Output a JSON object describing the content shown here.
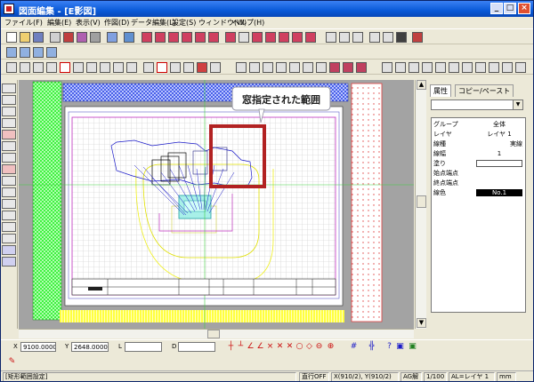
{
  "window": {
    "title": "図面編集 - [E影図]"
  },
  "menu": [
    {
      "label": "ファイル(F)"
    },
    {
      "label": "編集(E)"
    },
    {
      "label": "表示(V)"
    },
    {
      "label": "作図(D)"
    },
    {
      "label": "データ編集(L)"
    },
    {
      "label": "設定(S)"
    },
    {
      "label": "ウィンドウ(W)"
    },
    {
      "label": "ヘルプ(H)"
    }
  ],
  "panel": {
    "tabs": [
      {
        "label": "属性"
      },
      {
        "label": "コピー/ペースト"
      }
    ],
    "properties": [
      {
        "key": "グループ",
        "value": "全体"
      },
      {
        "key": "レイヤ",
        "value": "レイヤ 1"
      },
      {
        "key": "線種",
        "value": "実線"
      },
      {
        "key": "線幅",
        "value": "1"
      },
      {
        "key": "塗り",
        "value": ""
      },
      {
        "key": "始点端点",
        "value": ""
      },
      {
        "key": "終点端点",
        "value": ""
      },
      {
        "key": "線色",
        "value": "No.1"
      }
    ]
  },
  "callout": {
    "text": "窓指定された範囲"
  },
  "coords": {
    "x_label": "X",
    "x_value": "9100.0000",
    "y_label": "Y",
    "y_value": "2648.0000",
    "l_label": "L",
    "d_label": "D"
  },
  "status": {
    "message": "[矩形範囲設定]",
    "grid": "直行OFF",
    "position": "X(910/2), Y(910/2)",
    "snap": "AG解",
    "scale": "1/100",
    "layer": "AL=レイヤ 1",
    "unit": "mm"
  },
  "colors": {
    "accent": "#0a5ad8",
    "highlight_rect": "#b22222",
    "drawing_line": "#1a1ac8",
    "sheet_border": "#c030c0"
  }
}
